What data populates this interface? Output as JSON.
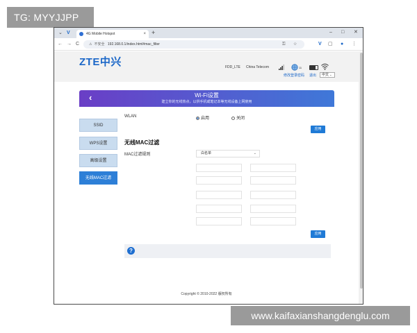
{
  "overlays": {
    "tg_badge": "TG: MYYJJPP",
    "watermark": "www.kaifaxianshangdenglu.com"
  },
  "browser": {
    "tab_title": "4G Mobile Hotspot",
    "tab_close": "×",
    "new_tab": "+",
    "window_minimize": "–",
    "window_maximize": "□",
    "window_close": "✕",
    "tab_list": "⌄",
    "back": "←",
    "forward": "→",
    "reload": "C",
    "security_label": "不安全",
    "url": "192.168.0.1/index.html#mac_filter",
    "menu": "⋮"
  },
  "header": {
    "logo_text": "ZTE中兴",
    "network_name": "FDD_LTE",
    "carrier": "China Telecom",
    "net_type": "11",
    "battery_level": 0.7,
    "link_change_password": "修改登录密码",
    "link_logout": "退出",
    "language": "中文"
  },
  "banner": {
    "back_icon": "‹",
    "title": "Wi-Fi设置",
    "description": "建立你的无线热点，以供手机或笔记本等无线设备上网使用"
  },
  "sidebar": {
    "items": [
      {
        "label": "SSID",
        "active": false
      },
      {
        "label": "WPS设置",
        "active": false
      },
      {
        "label": "高级设置",
        "active": false
      },
      {
        "label": "无线MAC过滤",
        "active": true
      }
    ]
  },
  "form": {
    "wlan_label": "WLAN",
    "option_enable": "启用",
    "option_disable": "关闭",
    "wlan_enabled": true,
    "apply_label": "应用",
    "section_title": "无线MAC过滤",
    "mac_rule_label": "MAC过滤规则",
    "mac_rule_value": "白名单",
    "mac_inputs": [
      "",
      "",
      "",
      "",
      "",
      "",
      "",
      "",
      "",
      ""
    ],
    "apply_label_bottom": "应用",
    "help_icon": "?"
  },
  "footer": {
    "copyright": "Copyright © 2010-2022 版权所有"
  },
  "colors": {
    "brand_blue": "#1b67c8",
    "button_blue": "#1f7ad6",
    "banner_start": "#6a3ec6",
    "banner_end": "#3f78d8",
    "sidebar_active": "#2d7fd7",
    "sidebar_inactive": "#c9dcef"
  }
}
